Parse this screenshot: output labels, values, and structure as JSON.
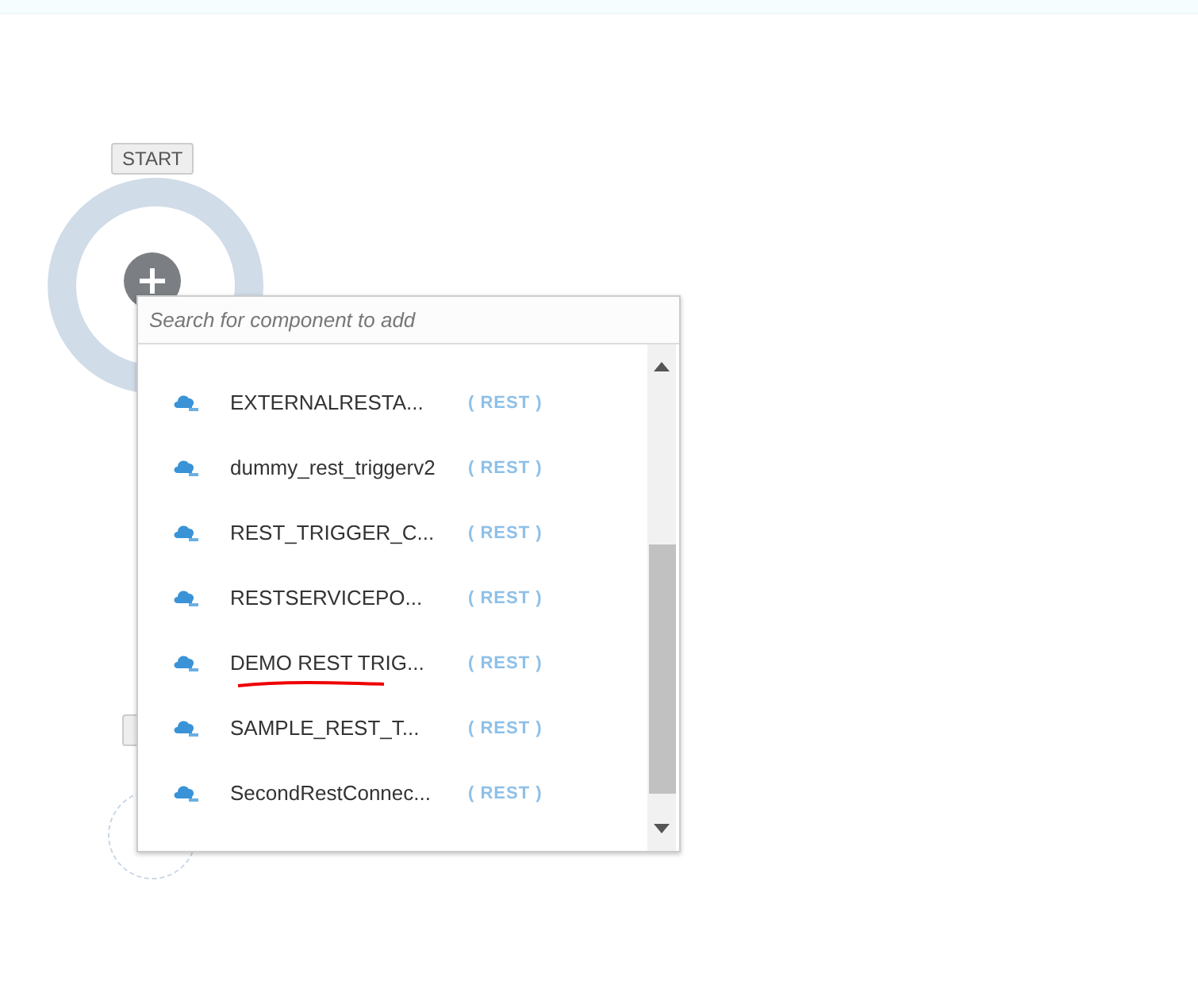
{
  "start_node": {
    "label": "START"
  },
  "picker": {
    "search": {
      "placeholder": "Search for component to add"
    },
    "items": [
      {
        "name": "EXTERNALRESTA...",
        "type": "( REST )",
        "underlined": false
      },
      {
        "name": "dummy_rest_triggerv2",
        "type": "( REST )",
        "underlined": false
      },
      {
        "name": "REST_TRIGGER_C...",
        "type": "( REST )",
        "underlined": false
      },
      {
        "name": "RESTSERVICEPO...",
        "type": "( REST )",
        "underlined": false
      },
      {
        "name": "DEMO REST TRIG...",
        "type": "( REST )",
        "underlined": true
      },
      {
        "name": "SAMPLE_REST_T...",
        "type": "( REST )",
        "underlined": false
      },
      {
        "name": "SecondRestConnec...",
        "type": "( REST )",
        "underlined": false
      }
    ]
  }
}
